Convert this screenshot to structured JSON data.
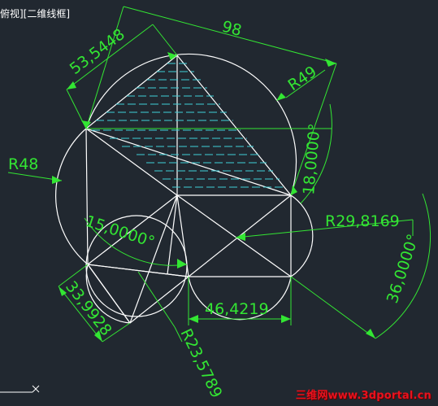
{
  "viewport": {
    "label": "俯视][二维线框]"
  },
  "dimensions": {
    "aligned_98": "98",
    "aligned_53": "53,5448",
    "radius_49": "R49",
    "angle_18": "18,0000°",
    "radius_48": "R48",
    "angle_15": "15,0000°",
    "radius_29": "R29,8169",
    "angle_36": "36,0000°",
    "linear_46": "46,4219",
    "aligned_33": "33,9928",
    "radius_23": "R23,5789"
  },
  "watermark": "三维网www.3dportal.cn",
  "colors": {
    "background": "#212830",
    "geometry": "#ffffff",
    "dimension": "#33e633",
    "hatch": "#3fd0d8",
    "watermark": "#e8121e"
  }
}
